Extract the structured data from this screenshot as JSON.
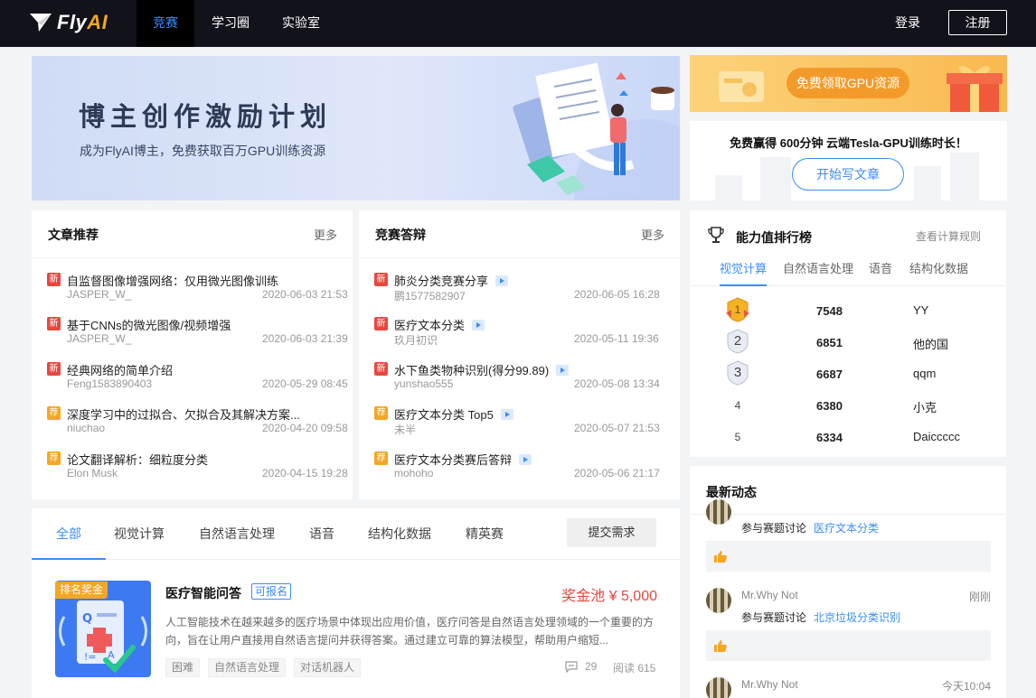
{
  "nav": {
    "logo_prefix": "Fly",
    "logo_suffix": "AI",
    "items": [
      {
        "label": "竞赛"
      },
      {
        "label": "学习圈"
      },
      {
        "label": "实验室"
      }
    ],
    "login": "登录",
    "register": "注册"
  },
  "banner": {
    "title": "博主创作激励计划",
    "subtitle": "成为FlyAI博主，免费获取百万GPU训练资源"
  },
  "gpu": {
    "promo_button": "免费领取GPU资源",
    "card_title": "免费赢得 600分钟 云端Tesla-GPU训练时长！",
    "card_button": "开始写文章"
  },
  "articles": {
    "title": "文章推荐",
    "more": "更多",
    "items": [
      {
        "tag": "新",
        "title": "自监督图像增强网络：仅用微光图像训练",
        "author": "JASPER_W_",
        "date": "2020-06-03 21:53"
      },
      {
        "tag": "新",
        "title": "基于CNNs的微光图像/视频增强",
        "author": "JASPER_W_",
        "date": "2020-06-03 21:39"
      },
      {
        "tag": "新",
        "title": "经典网络的简单介绍",
        "author": "Feng1583890403",
        "date": "2020-05-29 08:45"
      },
      {
        "tag": "荐",
        "title": "深度学习中的过拟合、欠拟合及其解决方案...",
        "author": "niuchao",
        "date": "2020-04-20 09:58"
      },
      {
        "tag": "荐",
        "title": "论文翻译解析：细粒度分类",
        "author": "Elon Musk",
        "date": "2020-04-15 19:28"
      }
    ]
  },
  "defense": {
    "title": "竞赛答辩",
    "more": "更多",
    "items": [
      {
        "tag": "新",
        "title": "肺炎分类竞赛分享",
        "author": "鹏1577582907",
        "date": "2020-06-05 16:28"
      },
      {
        "tag": "新",
        "title": "医疗文本分类",
        "author": "玖月初识",
        "date": "2020-05-11 19:36"
      },
      {
        "tag": "新",
        "title": "水下鱼类物种识别(得分99.89)",
        "author": "yunshao555",
        "date": "2020-05-08 13:34"
      },
      {
        "tag": "荐",
        "title": "医疗文本分类 Top5",
        "author": "未半",
        "date": "2020-05-07 21:53"
      },
      {
        "tag": "荐",
        "title": "医疗文本分类赛后答辩",
        "author": "mohoho",
        "date": "2020-05-06 21:17"
      }
    ]
  },
  "ranking": {
    "title": "能力值排行榜",
    "rule": "查看计算规则",
    "tabs": [
      "视觉计算",
      "自然语言处理",
      "语音",
      "结构化数据"
    ],
    "rows": [
      {
        "rank": "1",
        "score": "7548",
        "name": "YY"
      },
      {
        "rank": "2",
        "score": "6851",
        "name": "他的国"
      },
      {
        "rank": "3",
        "score": "6687",
        "name": "qqm"
      },
      {
        "rank": "4",
        "score": "6380",
        "name": "小克"
      },
      {
        "rank": "5",
        "score": "6334",
        "name": "Daiccccc"
      }
    ]
  },
  "activity": {
    "title": "最新动态",
    "items": [
      {
        "user": "",
        "time": "",
        "action": "参与赛题讨论",
        "topic": "医疗文本分类"
      },
      {
        "user": "Mr.Why Not",
        "time": "刚刚",
        "action": "参与赛题讨论",
        "topic": "北京垃圾分类识别"
      },
      {
        "user": "Mr.Why Not",
        "time": "今天10:04",
        "action": "",
        "topic": ""
      }
    ]
  },
  "competitions": {
    "tabs": [
      "全部",
      "视觉计算",
      "自然语言处理",
      "语音",
      "结构化数据",
      "精英赛"
    ],
    "request": "提交需求",
    "item": {
      "badge": "排名奖金",
      "name": "医疗智能问答",
      "status": "可报名",
      "prize": "奖金池 ¥ 5,000",
      "description": "人工智能技术在越来越多的医疗场景中体现出应用价值，医疗问答是自然语言处理领域的一个重要的方向，旨在让用户直接用自然语言提问并获得答案。通过建立可靠的算法模型，帮助用户缩短...",
      "chips": [
        "困难",
        "自然语言处理",
        "对话机器人"
      ],
      "comments": "29",
      "reads": "阅读 615"
    }
  }
}
